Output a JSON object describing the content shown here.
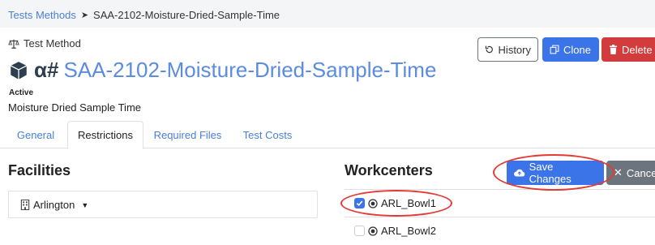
{
  "breadcrumb": {
    "parent": "Tests Methods",
    "separator": "➤",
    "current": "SAA-2102-Moisture-Dried-Sample-Time"
  },
  "header": {
    "type_label": "Test Method",
    "title_prefix": "α#",
    "title": "SAA-2102-Moisture-Dried-Sample-Time",
    "status": "Active",
    "subtitle": "Moisture Dried Sample Time"
  },
  "actions": {
    "history": "History",
    "clone": "Clone",
    "delete": "Delete"
  },
  "tabs": [
    {
      "label": "General"
    },
    {
      "label": "Restrictions",
      "active": true
    },
    {
      "label": "Required Files"
    },
    {
      "label": "Test Costs"
    }
  ],
  "facilities": {
    "heading": "Facilities",
    "selected": "Arlington"
  },
  "workcenters": {
    "heading": "Workcenters",
    "save_label": "Save Changes",
    "cancel_label": "Cancel",
    "items": [
      {
        "label": "ARL_Bowl1",
        "checked": true
      },
      {
        "label": "ARL_Bowl2",
        "checked": false
      }
    ]
  },
  "colors": {
    "primary": "#3b73e8",
    "danger": "#d23c3c",
    "secondary": "#6c757d",
    "link": "#4a7fd6",
    "annotation": "#e53935"
  }
}
